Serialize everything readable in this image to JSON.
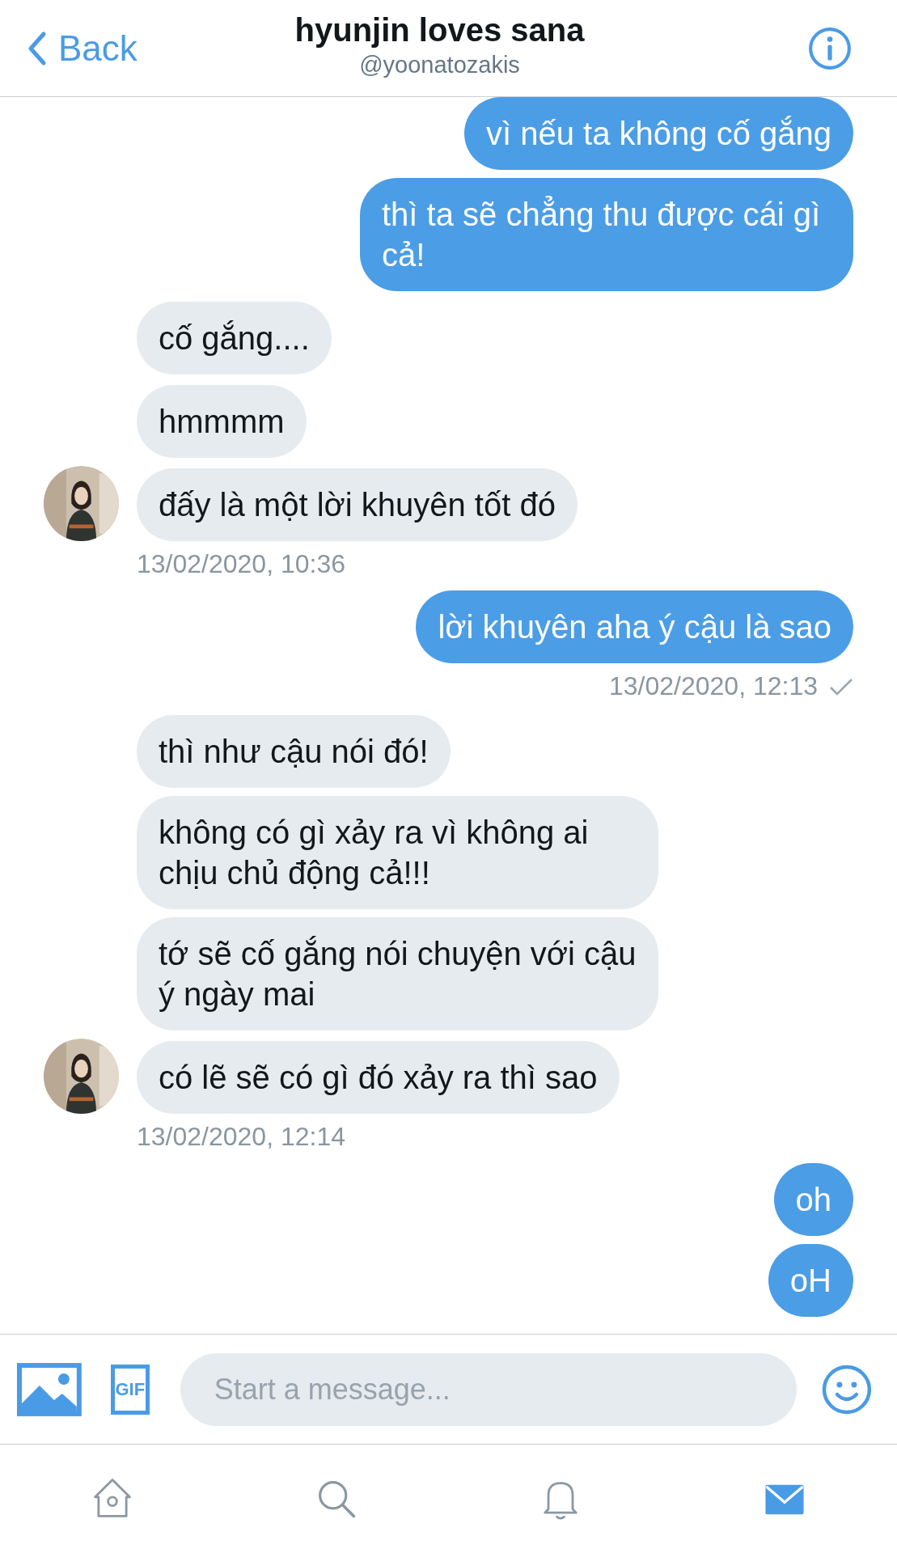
{
  "header": {
    "back_label": "Back",
    "title": "hyunjin loves sana",
    "subtitle": "@yoonatozakis"
  },
  "messages": [
    {
      "kind": "sent",
      "text": "vì nếu ta không cố gắng"
    },
    {
      "kind": "sent",
      "text": "thì ta sẽ chẳng thu được cái gì cả!"
    },
    {
      "kind": "received",
      "text": "cố gắng....",
      "avatar": false
    },
    {
      "kind": "received",
      "text": "hmmmm",
      "avatar": false
    },
    {
      "kind": "received",
      "text": "đấy là một lời khuyên tốt đó",
      "avatar": true
    },
    {
      "kind": "received_time",
      "text": "13/02/2020, 10:36",
      "check": false
    },
    {
      "kind": "sent",
      "text": "lời khuyên aha ý cậu là sao"
    },
    {
      "kind": "sent_time",
      "text": "13/02/2020, 12:13",
      "check": true
    },
    {
      "kind": "received",
      "text": "thì như cậu nói đó!",
      "avatar": false
    },
    {
      "kind": "received",
      "text": "không có gì xảy ra vì không ai chịu chủ động cả!!!",
      "avatar": false
    },
    {
      "kind": "received",
      "text": "tớ sẽ cố gắng nói chuyện với cậu ý ngày mai",
      "avatar": false
    },
    {
      "kind": "received",
      "text": "có lẽ sẽ có gì đó xảy ra thì sao",
      "avatar": true
    },
    {
      "kind": "received_time",
      "text": "13/02/2020, 12:14",
      "check": false
    },
    {
      "kind": "sent",
      "text": "oh"
    },
    {
      "kind": "sent",
      "text": "oH"
    }
  ],
  "composer": {
    "gif_label": "GIF",
    "placeholder": "Start a message..."
  },
  "tabs": [
    {
      "kind": "home",
      "selected": false
    },
    {
      "kind": "search",
      "selected": false
    },
    {
      "kind": "notifications",
      "selected": false
    },
    {
      "kind": "messages",
      "selected": true
    }
  ]
}
